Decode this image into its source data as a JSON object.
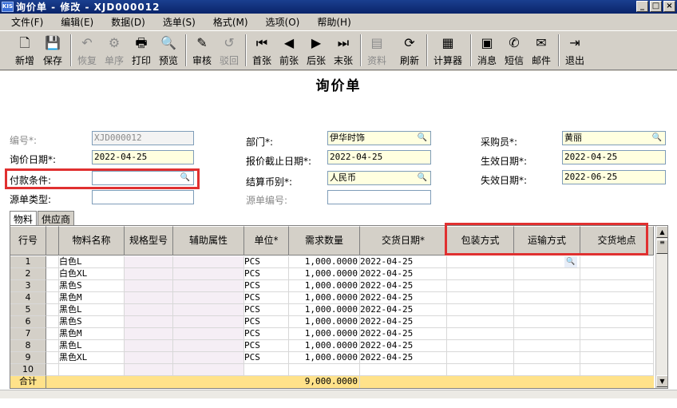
{
  "window": {
    "app_icon": "KIS",
    "title": "询价单 - 修改 - XJD000012",
    "controls": [
      "_",
      "□",
      "×"
    ]
  },
  "menu": [
    "文件(F)",
    "编辑(E)",
    "数据(D)",
    "选单(S)",
    "格式(M)",
    "选项(O)",
    "帮助(H)"
  ],
  "toolbar": [
    {
      "label": "新增",
      "icon": "new-document-icon",
      "glyph": "🗋",
      "enabled": true
    },
    {
      "label": "保存",
      "icon": "save-icon",
      "glyph": "💾",
      "enabled": true
    },
    {
      "label": "恢复",
      "icon": "undo-icon",
      "glyph": "↶",
      "enabled": false
    },
    {
      "label": "单序",
      "icon": "sequence-icon",
      "glyph": "⚙",
      "enabled": false
    },
    {
      "label": "打印",
      "icon": "print-icon",
      "glyph": "🖶",
      "enabled": true
    },
    {
      "label": "预览",
      "icon": "preview-icon",
      "glyph": "🔍",
      "enabled": true
    },
    {
      "label": "审核",
      "icon": "approve-icon",
      "glyph": "✎",
      "enabled": true
    },
    {
      "label": "驳回",
      "icon": "reject-icon",
      "glyph": "↺",
      "enabled": false
    },
    {
      "label": "首张",
      "icon": "first-icon",
      "glyph": "⏮",
      "enabled": true
    },
    {
      "label": "前张",
      "icon": "previous-icon",
      "glyph": "◀",
      "enabled": true
    },
    {
      "label": "后张",
      "icon": "next-icon",
      "glyph": "▶",
      "enabled": true
    },
    {
      "label": "末张",
      "icon": "last-icon",
      "glyph": "⏭",
      "enabled": true
    },
    {
      "label": "资料",
      "icon": "data-icon",
      "glyph": "▤",
      "enabled": false
    },
    {
      "label": "刷新",
      "icon": "refresh-icon",
      "glyph": "⟳",
      "enabled": true
    },
    {
      "label": "计算器",
      "icon": "calculator-icon",
      "glyph": "▦",
      "enabled": true
    },
    {
      "label": "消息",
      "icon": "message-icon",
      "glyph": "▣",
      "enabled": true
    },
    {
      "label": "短信",
      "icon": "sms-icon",
      "glyph": "✆",
      "enabled": true
    },
    {
      "label": "邮件",
      "icon": "mail-icon",
      "glyph": "✉",
      "enabled": true
    },
    {
      "label": "退出",
      "icon": "exit-icon",
      "glyph": "⇥",
      "enabled": true
    }
  ],
  "form": {
    "title": "询价单",
    "number_label": "编号*:",
    "number_value": "XJD000012",
    "inquiry_date_label": "询价日期*:",
    "inquiry_date_value": "2022-04-25",
    "payment_label": "付款条件:",
    "payment_value": "",
    "source_type_label": "源单类型:",
    "source_type_value": "",
    "dept_label": "部门*:",
    "dept_value": "伊华时饰",
    "quote_deadline_label": "报价截止日期*:",
    "quote_deadline_value": "2022-04-25",
    "currency_label": "结算币别*:",
    "currency_value": "人民币",
    "source_no_label": "源单编号:",
    "source_no_value": "",
    "buyer_label": "采购员*:",
    "buyer_value": "黄丽",
    "effective_label": "生效日期*:",
    "effective_value": "2022-04-25",
    "expiry_label": "失效日期*:",
    "expiry_value": "2022-06-25"
  },
  "tabs": [
    "物料",
    "供应商"
  ],
  "grid": {
    "columns": [
      "行号",
      "",
      "物料名称",
      "规格型号",
      "辅助属性",
      "单位*",
      "需求数量",
      "交货日期*",
      "包装方式",
      "运输方式",
      "交货地点"
    ],
    "rows": [
      {
        "no": "1",
        "name": "白色L",
        "unit": "PCS",
        "qty": "1,000.0000",
        "date": "2022-04-25"
      },
      {
        "no": "2",
        "name": "白色XL",
        "unit": "PCS",
        "qty": "1,000.0000",
        "date": "2022-04-25"
      },
      {
        "no": "3",
        "name": "黑色S",
        "unit": "PCS",
        "qty": "1,000.0000",
        "date": "2022-04-25"
      },
      {
        "no": "4",
        "name": "黑色M",
        "unit": "PCS",
        "qty": "1,000.0000",
        "date": "2022-04-25"
      },
      {
        "no": "5",
        "name": "黑色L",
        "unit": "PCS",
        "qty": "1,000.0000",
        "date": "2022-04-25"
      },
      {
        "no": "6",
        "name": "黑色S",
        "unit": "PCS",
        "qty": "1,000.0000",
        "date": "2022-04-25"
      },
      {
        "no": "7",
        "name": "黑色M",
        "unit": "PCS",
        "qty": "1,000.0000",
        "date": "2022-04-25"
      },
      {
        "no": "8",
        "name": "黑色L",
        "unit": "PCS",
        "qty": "1,000.0000",
        "date": "2022-04-25"
      },
      {
        "no": "9",
        "name": "黑色XL",
        "unit": "PCS",
        "qty": "1,000.0000",
        "date": "2022-04-25"
      },
      {
        "no": "10",
        "name": "",
        "unit": "",
        "qty": "",
        "date": ""
      }
    ],
    "total_label": "合计",
    "total_qty": "9,000.0000"
  },
  "highlight_color": "#e03030"
}
